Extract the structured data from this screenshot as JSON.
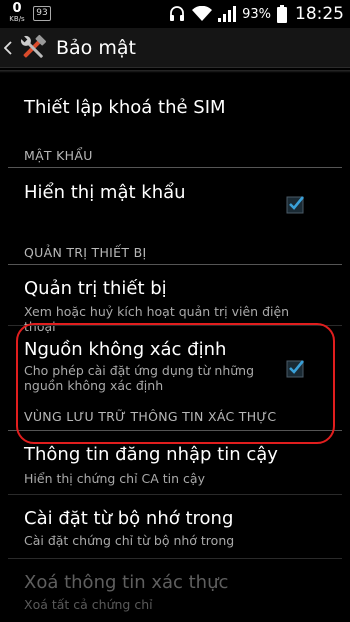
{
  "status_bar": {
    "speed_value": "0",
    "speed_unit": "KB/s",
    "badge": "93",
    "battery": "93%",
    "time": "18:25"
  },
  "action_bar": {
    "title": "Bảo mật",
    "back_icon": "chevron-left-icon",
    "app_icon": "tools-icon"
  },
  "items": {
    "sim_lock": {
      "title": "Thiết lập khoá thẻ SIM"
    },
    "passwords_header": "MẬT KHẨU",
    "show_password": {
      "title": "Hiển thị mật khẩu",
      "checked": true
    },
    "device_admin_header": "QUẢN TRỊ THIẾT BỊ",
    "device_admins": {
      "title": "Quản trị thiết bị",
      "subtitle": "Xem hoặc huỷ kích hoạt quản trị viên điện thoại"
    },
    "unknown_sources": {
      "title": "Nguồn không xác định",
      "subtitle": "Cho phép cài đặt ứng dụng từ những nguồn không xác định",
      "checked": true
    },
    "credential_storage_header": "VÙNG LƯU TRỮ THÔNG TIN XÁC THỰC",
    "trusted_credentials": {
      "title": "Thông tin đăng nhập tin cậy",
      "subtitle": "Hiển thị chứng chỉ CA tin cậy"
    },
    "install_from_storage": {
      "title": "Cài đặt từ bộ nhớ trong",
      "subtitle": "Cài đặt chứng chỉ từ bộ nhớ trong"
    },
    "clear_credentials": {
      "title": "Xoá thông tin xác thực",
      "subtitle": "Xoá tất cả chứng chỉ",
      "enabled": false
    }
  },
  "colors": {
    "accent_check": "#3aa0d8",
    "highlight_outline": "#e11e1e"
  }
}
